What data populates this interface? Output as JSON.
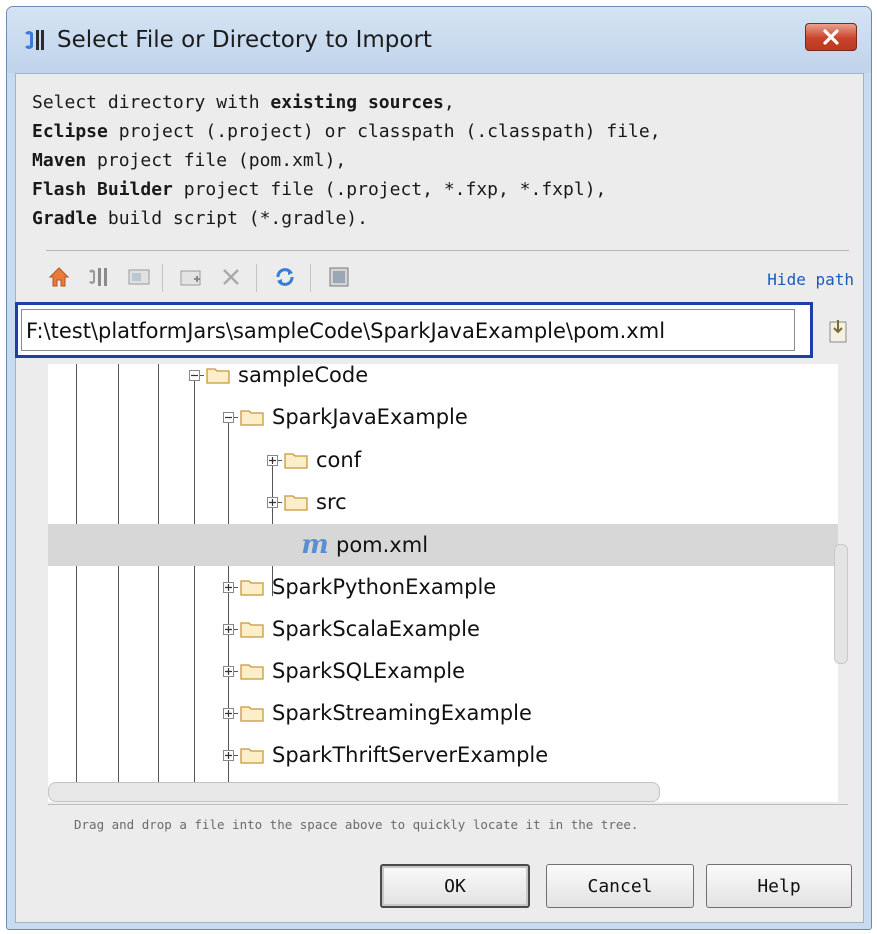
{
  "window": {
    "title": "Select File or Directory to Import",
    "close_icon": "close-icon",
    "app_icon": "intellij-idea-icon"
  },
  "description": {
    "line1_a": "Select directory with ",
    "line1_b": "existing sources",
    "line1_c": ",",
    "line2_a": "Eclipse",
    "line2_b": " project (.project) or classpath (.classpath) file,",
    "line3_a": "Maven",
    "line3_b": " project file (pom.xml),",
    "line4_a": "Flash Builder",
    "line4_b": " project file (.project, *.fxp, *.fxpl),",
    "line5_a": "Gradle",
    "line5_b": " build script (*.gradle)."
  },
  "toolbar": {
    "icons": [
      "home-icon",
      "project-icon",
      "desktop-icon",
      "new-folder-icon",
      "delete-icon",
      "refresh-icon",
      "show-hidden-icon"
    ],
    "hide_path_label": "Hide path"
  },
  "path": {
    "value": "F:\\test\\platformJars\\sampleCode\\SparkJavaExample\\pom.xml",
    "history_icon": "path-history-icon"
  },
  "tree": {
    "nodes": [
      {
        "label": "sampleCode",
        "type": "folder",
        "expanded": true
      },
      {
        "label": "SparkJavaExample",
        "type": "folder",
        "expanded": true
      },
      {
        "label": "conf",
        "type": "folder",
        "expanded": false
      },
      {
        "label": "src",
        "type": "folder",
        "expanded": false
      },
      {
        "label": "pom.xml",
        "type": "maven-file",
        "selected": true
      },
      {
        "label": "SparkPythonExample",
        "type": "folder",
        "expanded": false
      },
      {
        "label": "SparkScalaExample",
        "type": "folder",
        "expanded": false
      },
      {
        "label": "SparkSQLExample",
        "type": "folder",
        "expanded": false
      },
      {
        "label": "SparkStreamingExample",
        "type": "folder",
        "expanded": false
      },
      {
        "label": "SparkThriftServerExample",
        "type": "folder",
        "expanded": false
      }
    ]
  },
  "hint": "Drag and drop a file into the space above to quickly locate it in the tree.",
  "buttons": {
    "ok": "OK",
    "cancel": "Cancel",
    "help": "Help"
  },
  "colors": {
    "path_highlight": "#1f3ea8",
    "hide_path_link": "#1a5bb8",
    "selected_row": "#d7d7d7"
  }
}
